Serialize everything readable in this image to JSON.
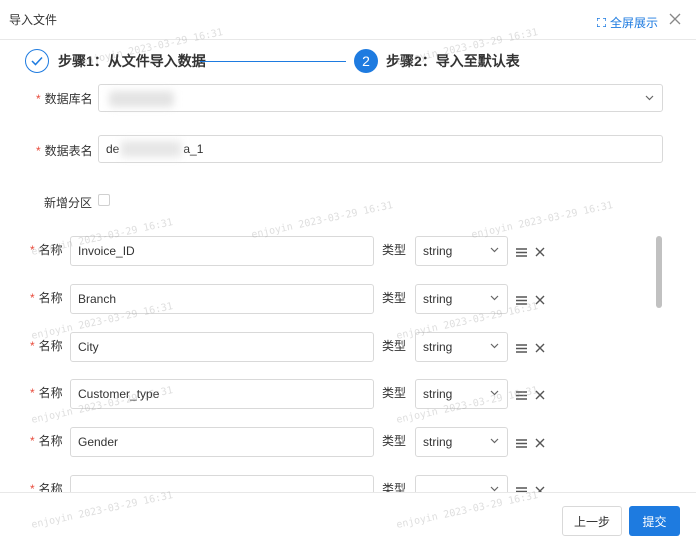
{
  "dialog": {
    "title": "导入文件",
    "fullscreen_label": "全屏展示"
  },
  "steps": [
    {
      "label": "步骤1：从文件导入数据",
      "state": "done"
    },
    {
      "label": "步骤2：导入至默认表",
      "number": "2",
      "state": "active"
    }
  ],
  "form": {
    "db_label": "数据库名",
    "table_label": "数据表名",
    "table_value_start": "de",
    "table_value_end": "a_1",
    "partition_label": "新增分区",
    "partition_checked": false
  },
  "field_rows": {
    "name_label": "名称",
    "type_label": "类型",
    "items": [
      {
        "name": "Invoice_ID",
        "type": "string"
      },
      {
        "name": "Branch",
        "type": "string"
      },
      {
        "name": "City",
        "type": "string"
      },
      {
        "name": "Customer_type",
        "type": "string"
      },
      {
        "name": "Gender",
        "type": "string"
      }
    ]
  },
  "footer": {
    "prev_label": "上一步",
    "submit_label": "提交"
  },
  "watermark": "enjoyin 2023-03-29 16:31",
  "colors": {
    "primary": "#1e7be0",
    "required": "#e84c3d"
  }
}
